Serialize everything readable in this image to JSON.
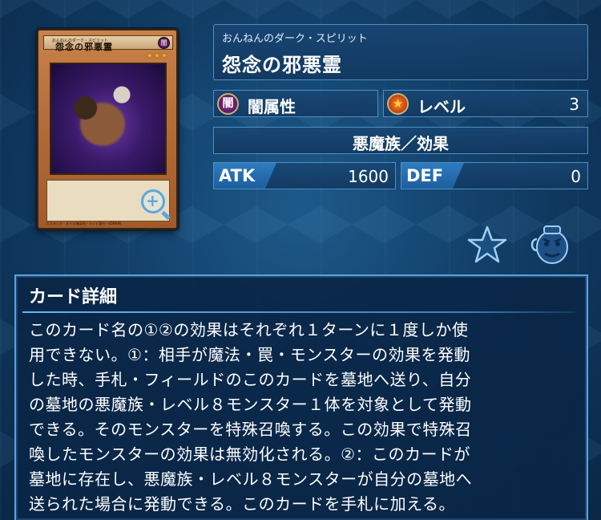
{
  "card_image": {
    "ruby": "おんねんのダーク・スピリット",
    "name": "怨念の邪悪霊",
    "attribute_glyph": "闇",
    "stars": "★★★",
    "copyright": "©スタジオ・ダイス/集英社・テレビ東京・KONAMI"
  },
  "card_info": {
    "ruby": "おんねんのダーク・スピリット",
    "name": "怨念の邪悪霊",
    "attribute": {
      "icon_glyph": "闇",
      "label": "闇属性"
    },
    "level": {
      "label": "レベル",
      "value": "3"
    },
    "type": "悪魔族／効果",
    "atk": {
      "label": "ATK",
      "value": "1600"
    },
    "def": {
      "label": "DEF",
      "value": "0"
    }
  },
  "actions": {
    "favorite_icon": "star-icon",
    "deck_icon": "pot-of-greed-icon"
  },
  "details": {
    "title": "カード詳細",
    "lines": [
      "このカード名の①②の効果はそれぞれ１ターンに１度しか使",
      "用できない。①：相手が魔法・罠・モンスターの効果を発動",
      "した時、手札・フィールドのこのカードを墓地へ送り、自分",
      "の墓地の悪魔族・レベル８モンスター１体を対象として発動",
      "できる。そのモンスターを特殊召喚する。この効果で特殊召",
      "喚したモンスターの効果は無効化される。②：このカードが",
      "墓地に存在し、悪魔族・レベル８モンスターが自分の墓地へ",
      "送られた場合に発動できる。このカードを手札に加える。"
    ]
  }
}
